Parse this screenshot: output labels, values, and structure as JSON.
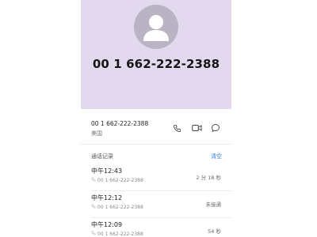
{
  "header": {
    "phone_number": "00 1 662-222-2388"
  },
  "contact": {
    "number": "00 1 662-222-2388",
    "region": "美国",
    "actions": [
      {
        "name": "phone-icon"
      },
      {
        "name": "video-call-icon"
      },
      {
        "name": "message-icon"
      }
    ]
  },
  "call_log": {
    "title": "通话记录",
    "clear_label": "清空",
    "entries": [
      {
        "time": "中午12:43",
        "number": "00 1 662-222-2388",
        "duration": "2 分 18 秒",
        "icon": "outgoing-call-icon"
      },
      {
        "time": "中午12:12",
        "number": "00 1 662-222-2388",
        "duration": "未接通",
        "icon": "unanswered-call-icon"
      },
      {
        "time": "中午12:09",
        "number": "00 1 662-222-2388",
        "duration": "54 秒",
        "icon": "outgoing-call-icon"
      }
    ]
  },
  "colors": {
    "hero_background": "#e2d9ee",
    "avatar": "#b9b3c4",
    "link": "#2f7de1"
  }
}
